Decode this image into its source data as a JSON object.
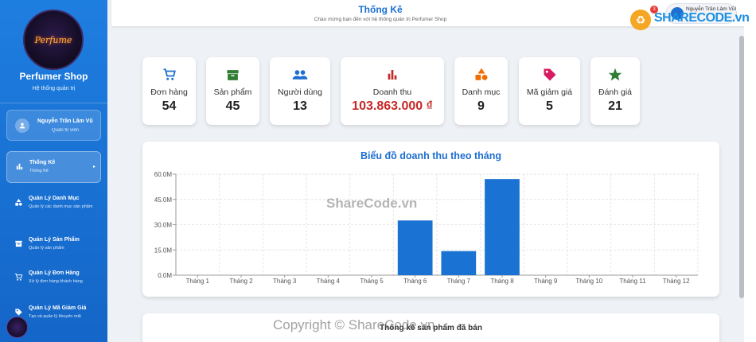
{
  "sidebar": {
    "shop_name": "Perfumer Shop",
    "shop_subtitle": "Hệ thống quản trị",
    "logo_text": "Perfume",
    "user": {
      "name": "Nguyễn Trần Lâm Vũ",
      "role": "Quản trị viên"
    },
    "items": [
      {
        "title": "Thống Kê",
        "desc": "Thống Kê",
        "icon": "bar-chart-icon",
        "active": true
      },
      {
        "title": "Quản Lý Danh Mục",
        "desc": "Quản lý các danh mục sản phẩm",
        "icon": "shapes-icon"
      },
      {
        "title": "Quản Lý Sản Phẩm",
        "desc": "Quản lý sản phẩm",
        "icon": "archive-icon"
      },
      {
        "title": "Quản Lý Đơn Hàng",
        "desc": "Xử lý đơn hàng khách hàng",
        "icon": "cart-icon"
      },
      {
        "title": "Quản Lý Mã Giảm Giá",
        "desc": "Tạo và quản lý khuyến mãi",
        "icon": "tag-icon"
      }
    ]
  },
  "header": {
    "title": "Thống Kê",
    "subtitle": "Chào mừng bạn đến với hệ thống quản trị Perfumer Shop",
    "user_name": "Nguyễn Trần Lâm VũI",
    "notification_count": "3"
  },
  "stats": [
    {
      "label": "Đơn hàng",
      "value": "54",
      "icon": "cart-icon",
      "color": "#1e6fd0"
    },
    {
      "label": "Sản phẩm",
      "value": "45",
      "icon": "archive-icon",
      "color": "#2e7d32"
    },
    {
      "label": "Người dùng",
      "value": "13",
      "icon": "people-icon",
      "color": "#1e6fd0"
    },
    {
      "label": "Doanh thu",
      "value": "103.863.000 ₫",
      "icon": "bar-chart-icon",
      "color": "#c62828"
    },
    {
      "label": "Danh mục",
      "value": "9",
      "icon": "shapes-icon",
      "color": "#ef6c00"
    },
    {
      "label": "Mã giảm giá",
      "value": "5",
      "icon": "tag-icon",
      "color": "#d81b60"
    },
    {
      "label": "Đánh giá",
      "value": "21",
      "icon": "star-icon",
      "color": "#2e7d32"
    }
  ],
  "chart_data": {
    "type": "bar",
    "title": "Biểu đồ doanh thu theo tháng",
    "categories": [
      "Tháng 1",
      "Tháng 2",
      "Tháng 3",
      "Tháng 4",
      "Tháng 5",
      "Tháng 6",
      "Tháng 7",
      "Tháng 8",
      "Tháng 9",
      "Tháng 10",
      "Tháng 11",
      "Tháng 12"
    ],
    "values": [
      0,
      0,
      0,
      0,
      0,
      32500000,
      14300000,
      57100000,
      0,
      0,
      0,
      0
    ],
    "ylim": [
      0,
      60000000
    ],
    "yticks": [
      "0.0M",
      "15.0M",
      "30.0M",
      "45.0M",
      "60.0M"
    ],
    "bar_color": "#1a73d2",
    "grid": true,
    "xlabel": "",
    "ylabel": ""
  },
  "bottom_section": {
    "title": "Thống kê sản phẩm đã bán"
  },
  "watermarks": {
    "logo_text": "SHARECODE.vn",
    "center": "ShareCode.vn",
    "copyright": "Copyright © ShareCode.vn"
  }
}
